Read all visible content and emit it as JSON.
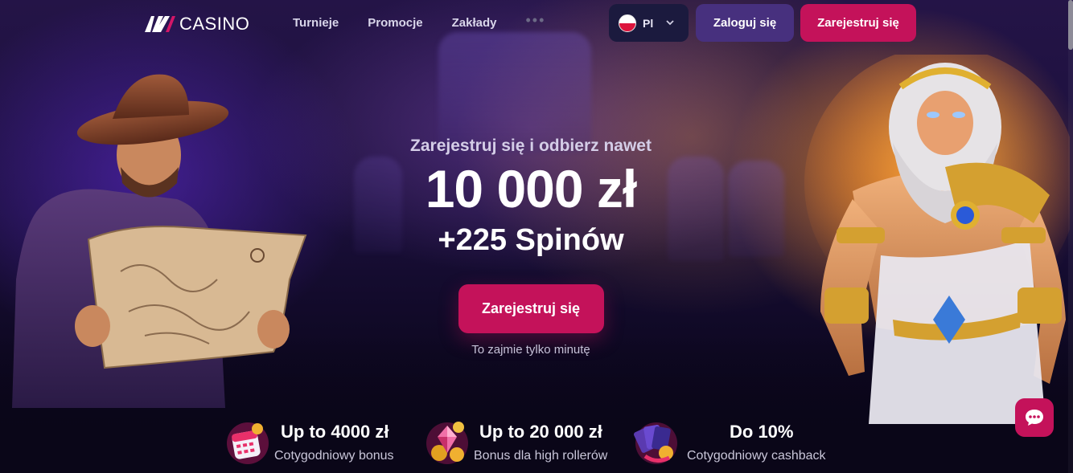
{
  "header": {
    "logo": "AV CASINO",
    "logo_text": "CASINO",
    "nav": [
      {
        "label": "Turnieje"
      },
      {
        "label": "Promocje"
      },
      {
        "label": "Zakłady"
      }
    ],
    "nav_more": "•••",
    "language": {
      "code": "Pl",
      "flag_icon": "poland-flag-icon"
    },
    "login_label": "Zaloguj się",
    "register_label": "Zarejestruj się"
  },
  "promo": {
    "subtitle": "Zarejestruj się i odbierz nawet",
    "amount": "10 000 zł",
    "spins": "+225 Spinów",
    "cta_label": "Zarejestruj się",
    "note": "To zajmie tylko minutę"
  },
  "features": [
    {
      "icon": "calendar-gift-icon",
      "title": "Up to 4000 zł",
      "desc": "Cotygodniowy bonus"
    },
    {
      "icon": "diamond-coins-icon",
      "title": "Up to 20 000 zł",
      "desc": "Bonus dla high rollerów"
    },
    {
      "icon": "cards-cashback-icon",
      "title": "Do 10%",
      "desc": "Cotygodniowy cashback"
    }
  ],
  "colors": {
    "accent_pink": "#c4125a",
    "accent_purple": "#47307e",
    "lang_bg": "#1b1a3e",
    "background": "#120a2a"
  },
  "chat": {
    "icon": "chat-bubble-icon"
  }
}
